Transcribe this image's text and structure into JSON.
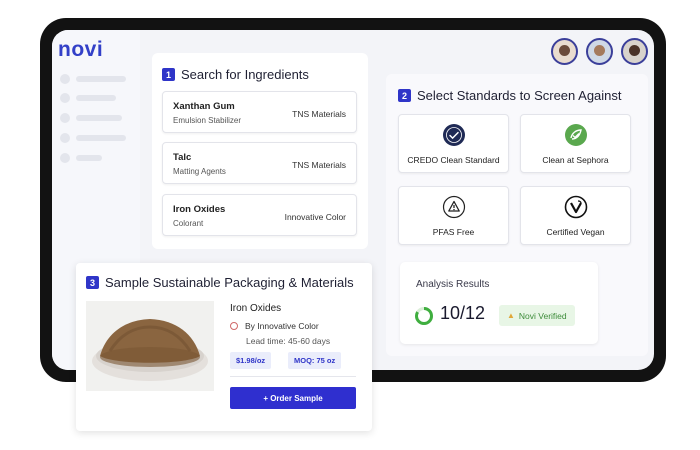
{
  "brand": {
    "logo": "novi"
  },
  "search": {
    "step": "1",
    "title": "Search for Ingredients",
    "ingredients": [
      {
        "name": "Xanthan Gum",
        "category": "Emulsion Stabilizer",
        "vendor": "TNS Materials"
      },
      {
        "name": "Talc",
        "category": "Matting Agents",
        "vendor": "TNS Materials"
      },
      {
        "name": "Iron Oxides",
        "category": "Colorant",
        "vendor": "Innovative Color"
      }
    ]
  },
  "standards": {
    "step": "2",
    "title": "Select Standards to Screen Against",
    "items": [
      {
        "label": "CREDO Clean Standard",
        "icon": "credo-seal-icon"
      },
      {
        "label": "Clean at Sephora",
        "icon": "leaf-check-icon"
      },
      {
        "label": "PFAS Free",
        "icon": "warning-triangle-icon"
      },
      {
        "label": "Certified Vegan",
        "icon": "vegan-v-icon"
      }
    ]
  },
  "analysis": {
    "title": "Analysis Results",
    "score": "10/12",
    "score_fraction": 0.833,
    "badge": "Novi Verified"
  },
  "packaging": {
    "step": "3",
    "title": "Sample Sustainable Packaging & Materials",
    "product_name": "Iron Oxides",
    "vendor": "By Innovative Color",
    "lead_time": "Lead time: 45-60 days",
    "price": "$1.98/oz",
    "moq": "MOQ: 75 oz",
    "order_label": "+ Order Sample"
  },
  "colors": {
    "accent": "#2f35c8",
    "verified_bg": "#e8f6e6",
    "verified_text": "#3d8c3a",
    "score_ring": "#3fae3f"
  }
}
